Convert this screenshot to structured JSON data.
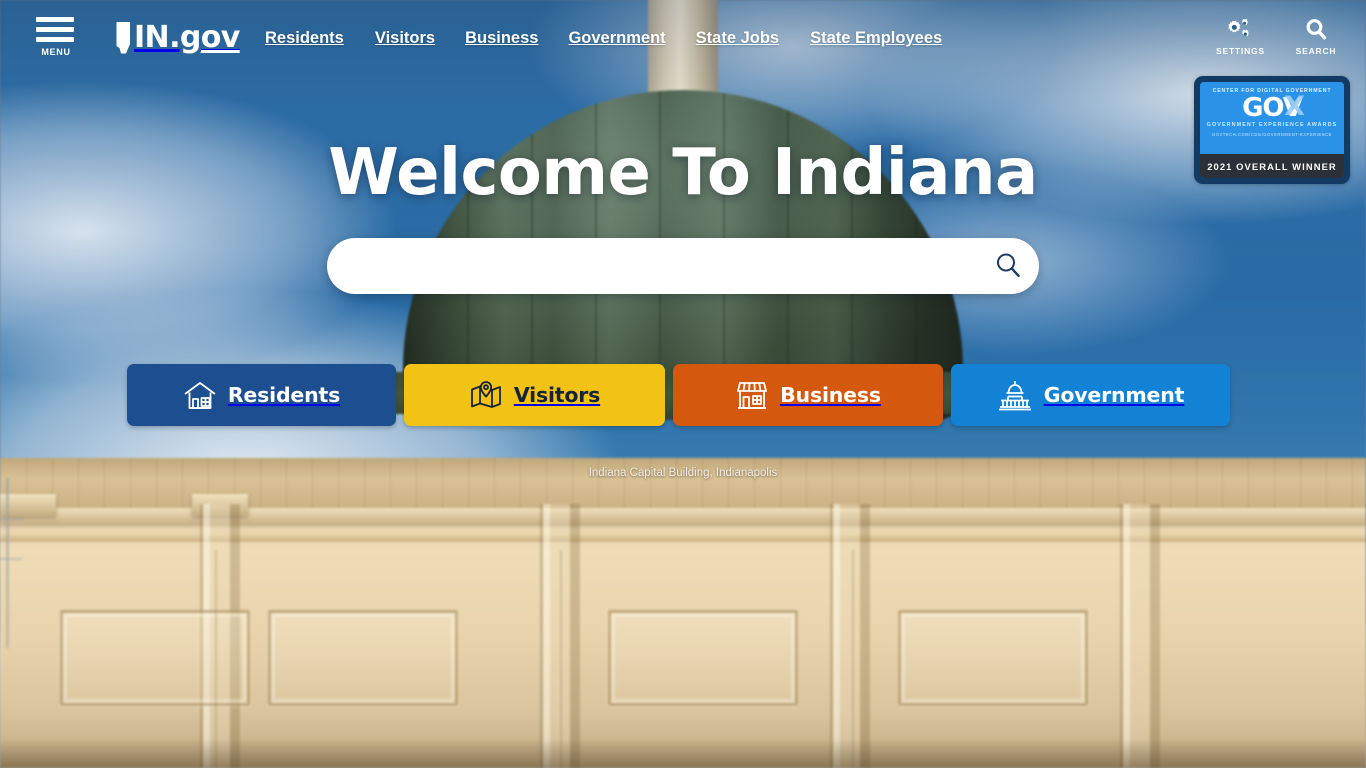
{
  "header": {
    "menu": {
      "label": "MENU",
      "icon": "hamburger-menu-icon"
    },
    "brand": {
      "in": "IN",
      "dot": ".",
      "gov": "gov",
      "icon": "indiana-state-shape-icon"
    },
    "nav": [
      {
        "label": "Residents"
      },
      {
        "label": "Visitors"
      },
      {
        "label": "Business"
      },
      {
        "label": "Government"
      },
      {
        "label": "State Jobs"
      },
      {
        "label": "State Employees"
      }
    ],
    "tools": [
      {
        "label": "SETTINGS",
        "icon": "gears-icon"
      },
      {
        "label": "SEARCH",
        "icon": "search-icon"
      }
    ]
  },
  "award_badge": {
    "organization": "CENTER FOR DIGITAL GOVERNMENT",
    "wordmark": "GOV",
    "wordmark_x": "X",
    "program": "GOVERNMENT EXPERIENCE AWARDS",
    "url": "GOVTECH.COM/CDG/GOVERNMENT-EXPERIENCE",
    "winner": "2021 OVERALL WINNER"
  },
  "hero": {
    "title": "Welcome To Indiana",
    "caption": "Indiana Capital Building, Indianapolis"
  },
  "search": {
    "value": "",
    "placeholder": "",
    "button_icon": "search-icon",
    "icon_color": "#1b3a66"
  },
  "categories": [
    {
      "label": "Residents",
      "icon": "house-icon",
      "color": "#1d4e8f",
      "text_color": "#ffffff"
    },
    {
      "label": "Visitors",
      "icon": "map-pin-icon",
      "color": "#f2c315",
      "text_color": "#15243a"
    },
    {
      "label": "Business",
      "icon": "storefront-icon",
      "color": "#d4590f",
      "text_color": "#ffffff"
    },
    {
      "label": "Government",
      "icon": "capitol-dome-icon",
      "color": "#1482d4",
      "text_color": "#ffffff"
    }
  ],
  "colors": {
    "brand_blue": "#1d4e8f",
    "accent_yellow": "#f2c315",
    "accent_orange": "#d4590f",
    "accent_light_blue": "#1482d4",
    "badge_frame": "#123a63",
    "badge_body": "#2a93e8",
    "badge_footer": "#2c3038"
  }
}
